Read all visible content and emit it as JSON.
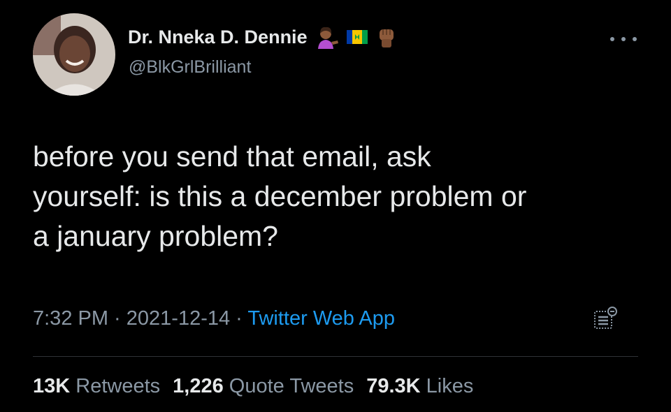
{
  "author": {
    "display_name": "Dr. Nneka D. Dennie",
    "handle": "@BlkGrlBrilliant",
    "badges": [
      "woman-tipping-hand-icon",
      "flag-st-vincent-icon",
      "raised-fist-icon"
    ]
  },
  "tweet": {
    "text": "before you send that email, ask\nyourself: is this a december problem or\na january problem?"
  },
  "meta": {
    "time": "7:32 PM",
    "separator": " · ",
    "date": "2021-12-14",
    "source": "Twitter Web App"
  },
  "stats": {
    "retweets_count": "13K",
    "retweets_label": "Retweets",
    "quotes_count": "1,226",
    "quotes_label": "Quote Tweets",
    "likes_count": "79.3K",
    "likes_label": "Likes"
  },
  "colors": {
    "background": "#000000",
    "text": "#e7e9ea",
    "secondary": "#8b98a5",
    "link": "#1d9bf0"
  }
}
